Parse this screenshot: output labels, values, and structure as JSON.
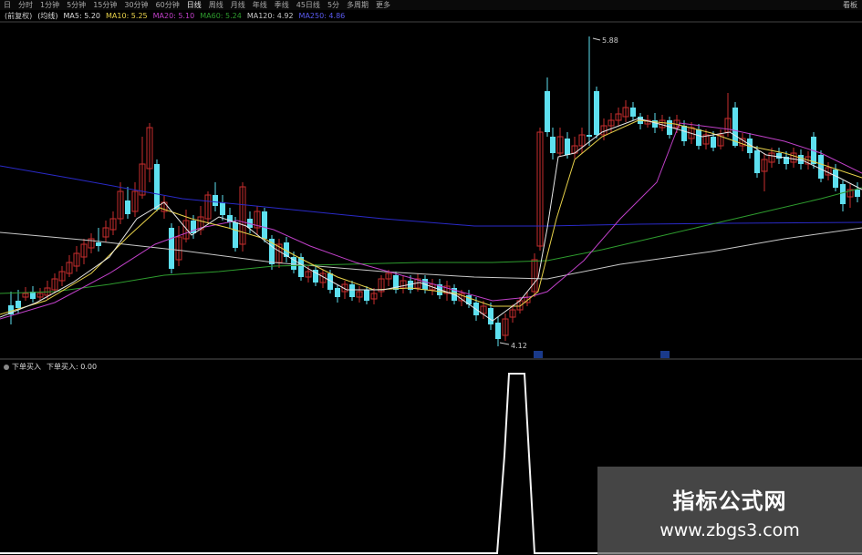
{
  "toolbar": {
    "items": [
      "日",
      "分时",
      "1分钟",
      "5分钟",
      "15分钟",
      "30分钟",
      "60分钟",
      "日线",
      "周线",
      "月线",
      "年线",
      "季线",
      "45日线",
      "5分",
      "多周期",
      "更多"
    ],
    "right_button": "看板"
  },
  "legend": {
    "prefix": "(前复权)",
    "indicator_name": "(均线)",
    "ma5": "MA5: 5.20",
    "ma10": "MA10: 5.25",
    "ma20": "MA20: 5.10",
    "ma60": "MA60: 5.24",
    "ma120": "MA120: 4.92",
    "ma250": "MA250: 4.86"
  },
  "annotations": {
    "high": "5.88",
    "low": "4.12"
  },
  "sub_panel": {
    "title": "下单买入",
    "value_label": "下单买入: 0.00"
  },
  "watermark": {
    "line1": "指标公式网",
    "line2": "www.zbgs3.com"
  },
  "colors": {
    "up": "#c82e2e",
    "down": "#5ee0f0",
    "ma5": "#e8e8e8",
    "ma10": "#e8d24a",
    "ma20": "#c040c8",
    "ma60": "#2e9c2e",
    "ma120": "#c8c8c8",
    "ma250": "#2a2ac8"
  }
}
